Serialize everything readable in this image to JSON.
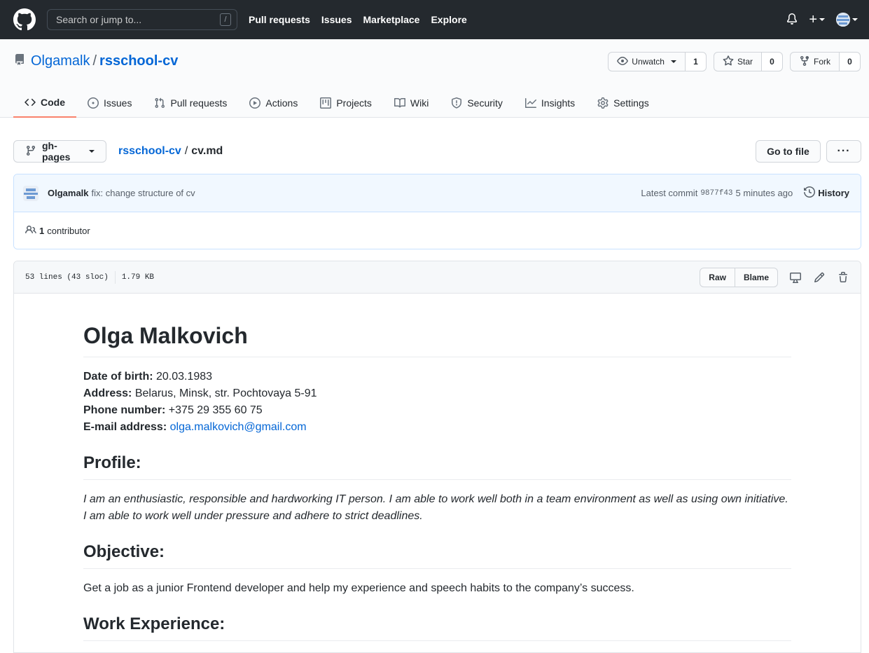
{
  "header": {
    "search_placeholder": "Search or jump to...",
    "search_shortcut": "/",
    "nav": [
      "Pull requests",
      "Issues",
      "Marketplace",
      "Explore"
    ]
  },
  "repo": {
    "owner": "Olgamalk",
    "separator": "/",
    "name": "rsschool-cv",
    "watch_label": "Unwatch",
    "watch_count": "1",
    "star_label": "Star",
    "star_count": "0",
    "fork_label": "Fork",
    "fork_count": "0"
  },
  "tabs": [
    {
      "label": "Code",
      "icon": "code-icon"
    },
    {
      "label": "Issues",
      "icon": "issue-icon"
    },
    {
      "label": "Pull requests",
      "icon": "pull-request-icon"
    },
    {
      "label": "Actions",
      "icon": "play-icon"
    },
    {
      "label": "Projects",
      "icon": "project-icon"
    },
    {
      "label": "Wiki",
      "icon": "book-icon"
    },
    {
      "label": "Security",
      "icon": "shield-icon"
    },
    {
      "label": "Insights",
      "icon": "graph-icon"
    },
    {
      "label": "Settings",
      "icon": "gear-icon"
    }
  ],
  "filenav": {
    "branch": "gh-pages",
    "crumb_repo": "rsschool-cv",
    "crumb_sep": "/",
    "crumb_file": "cv.md",
    "go_to_file": "Go to file",
    "more": "···"
  },
  "commit": {
    "author": "Olgamalk",
    "message": "fix: change structure of cv",
    "latest_label": "Latest commit",
    "sha": "9877f43",
    "time": "5 minutes ago",
    "history_label": "History",
    "contributors_count": "1",
    "contributors_label": "contributor"
  },
  "file": {
    "lines": "53 lines (43 sloc)",
    "size": "1.79 KB",
    "raw_label": "Raw",
    "blame_label": "Blame"
  },
  "cv": {
    "name": "Olga Malkovich",
    "dob_label": "Date of birth:",
    "dob": "20.03.1983",
    "address_label": "Address:",
    "address": "Belarus, Minsk, str. Pochtovaya 5-91",
    "phone_label": "Phone number:",
    "phone": "+375 29 355 60 75",
    "email_label": "E-mail address:",
    "email": "olga.malkovich@gmail.com",
    "profile_heading": "Profile:",
    "profile_text": "I am an enthusiastic, responsible and hardworking IT person. I am able to work well both in a team environment as well as using own initiative. I am able to work well under pressure and adhere to strict deadlines.",
    "objective_heading": "Objective:",
    "objective_text": "Get a job as a junior Frontend developer and help my experience and speech habits to the company’s success.",
    "work_heading": "Work Experience:"
  },
  "colors": {
    "header_bg": "#24292e",
    "link": "#0366d6",
    "active_tab_underline": "#f9826c"
  }
}
